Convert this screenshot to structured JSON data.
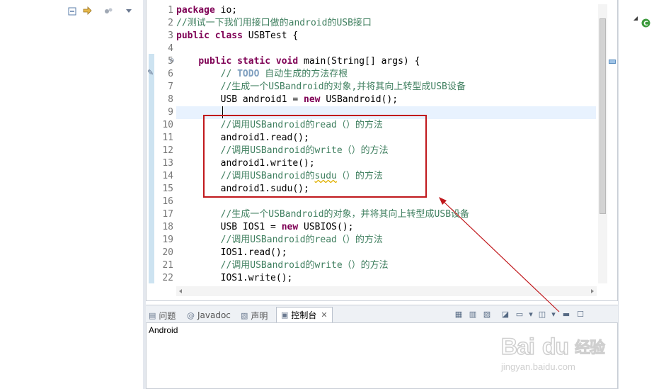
{
  "editor": {
    "line_numbers": [
      "1",
      "2",
      "3",
      "4",
      "5",
      "6",
      "7",
      "8",
      "9",
      "10",
      "11",
      "12",
      "13",
      "14",
      "15",
      "16",
      "17",
      "18",
      "19",
      "20",
      "21",
      "22"
    ],
    "lines": [
      {
        "segments": [
          [
            "kw",
            "package"
          ],
          [
            "var",
            " io;"
          ]
        ]
      },
      {
        "segments": [
          [
            "cm",
            "//测试一下我们用接口做的android的USB接口"
          ]
        ]
      },
      {
        "segments": [
          [
            "kw",
            "public class"
          ],
          [
            "var",
            " USBTest {"
          ]
        ]
      },
      {
        "segments": []
      },
      {
        "segments": [
          [
            "var",
            "    "
          ],
          [
            "kw",
            "public static void"
          ],
          [
            "var",
            " main(String[] args) {"
          ]
        ]
      },
      {
        "segments": [
          [
            "var",
            "        "
          ],
          [
            "cm",
            "// "
          ],
          [
            "todo",
            "TODO"
          ],
          [
            "cm",
            " 自动生成的方法存根"
          ]
        ]
      },
      {
        "segments": [
          [
            "var",
            "        "
          ],
          [
            "cm",
            "//生成一个USBandroid的对象,并将其向上转型成USB设备"
          ]
        ]
      },
      {
        "segments": [
          [
            "var",
            "        USB android1 = "
          ],
          [
            "kw",
            "new"
          ],
          [
            "var",
            " USBandroid();"
          ]
        ]
      },
      {
        "segments": []
      },
      {
        "segments": [
          [
            "var",
            "        "
          ],
          [
            "cm",
            "//调用USBandroid的read（）的方法"
          ]
        ]
      },
      {
        "segments": [
          [
            "var",
            "        android1.read();"
          ]
        ]
      },
      {
        "segments": [
          [
            "var",
            "        "
          ],
          [
            "cm",
            "//调用USBandroid的write（）的方法"
          ]
        ]
      },
      {
        "segments": [
          [
            "var",
            "        android1.write();"
          ]
        ]
      },
      {
        "segments": [
          [
            "var",
            "        "
          ],
          [
            "cm",
            "//调用USBandroid的"
          ],
          [
            "sq",
            "sudu"
          ],
          [
            "cm",
            "（）的方法"
          ]
        ]
      },
      {
        "segments": [
          [
            "var",
            "        android1.sudu();"
          ]
        ]
      },
      {
        "segments": []
      },
      {
        "segments": [
          [
            "var",
            "        "
          ],
          [
            "cm",
            "//生成一个USBandroid的对象，并将其向上转型成USB设备"
          ]
        ]
      },
      {
        "segments": [
          [
            "var",
            "        USB IOS1 = "
          ],
          [
            "kw",
            "new"
          ],
          [
            "var",
            " USBIOS();"
          ]
        ]
      },
      {
        "segments": [
          [
            "var",
            "        "
          ],
          [
            "cm",
            "//调用USBandroid的read（）的方法"
          ]
        ]
      },
      {
        "segments": [
          [
            "var",
            "        IOS1.read();"
          ]
        ]
      },
      {
        "segments": [
          [
            "var",
            "        "
          ],
          [
            "cm",
            "//调用USBandroid的write（）的方法"
          ]
        ]
      },
      {
        "segments": [
          [
            "var",
            "        IOS1.write();"
          ]
        ]
      }
    ]
  },
  "bottom_panel": {
    "tabs": [
      {
        "label": "问题",
        "icon": "problems-icon"
      },
      {
        "label": "Javadoc",
        "icon": "javadoc-icon"
      },
      {
        "label": "声明",
        "icon": "declaration-icon"
      },
      {
        "label": "控制台",
        "icon": "console-icon",
        "active": true
      }
    ],
    "console_output": "Android"
  },
  "watermark": {
    "logo": "Bai du 经验",
    "url": "jingyan.baidu.com"
  },
  "colors": {
    "keyword": "#7f0055",
    "comment": "#3f7f5f",
    "todo": "#7f9fbf",
    "highlight_box": "#c0181c",
    "current_line": "#e8f2fe"
  }
}
